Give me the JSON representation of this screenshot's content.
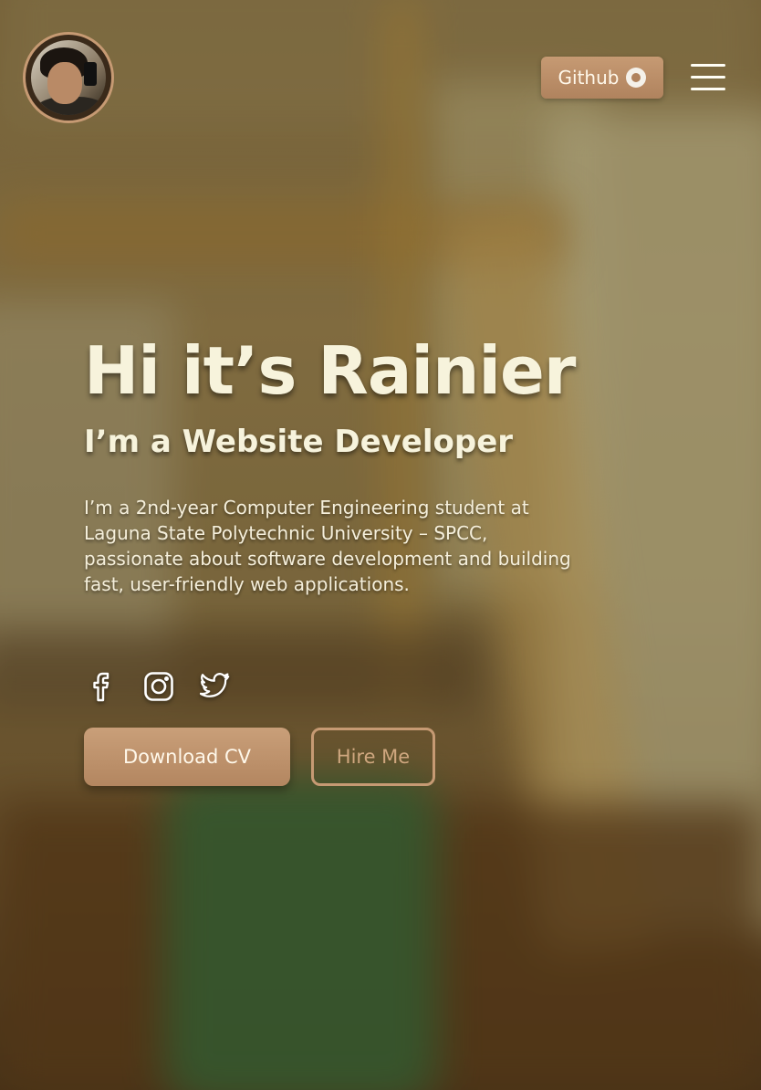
{
  "header": {
    "avatar_alt": "Rainier profile photo",
    "github_label": "Github",
    "github_icon": "github-icon",
    "menu_icon": "hamburger-menu-icon"
  },
  "hero": {
    "title": "Hi it’s Rainier",
    "subtitle": "I’m a Website Developer",
    "description": "I’m a 2nd-year Computer Engineering student at Laguna State Polytechnic University – SPCC, passionate about software development and building fast, user-friendly web applications."
  },
  "socials": [
    {
      "name": "facebook",
      "icon": "facebook-icon"
    },
    {
      "name": "instagram",
      "icon": "instagram-icon"
    },
    {
      "name": "twitter",
      "icon": "twitter-icon"
    }
  ],
  "actions": {
    "primary_label": "Download CV",
    "secondary_label": "Hire Me"
  },
  "colors": {
    "accent": "#c69a73",
    "text": "#f7f3dc"
  }
}
